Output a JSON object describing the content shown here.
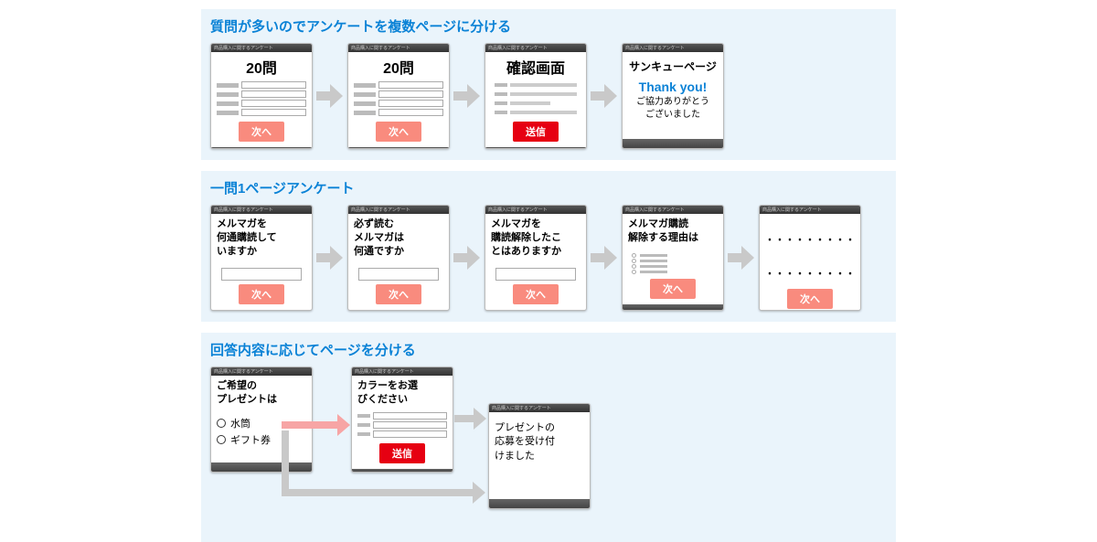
{
  "sections": [
    {
      "title": "質問が多いのでアンケートを複数ページに分ける",
      "cards": [
        {
          "header": "商品購入に関するアンケート",
          "title": "20問",
          "button": "次へ"
        },
        {
          "header": "商品購入に関するアンケート",
          "title": "20問",
          "button": "次へ"
        },
        {
          "header": "商品購入に関するアンケート",
          "title": "確認画面",
          "button": "送信"
        },
        {
          "header": "商品購入に関するアンケート",
          "thank_title": "サンキューページ",
          "thank_msg": "Thank you!",
          "thank_note1": "ご協力ありがとう",
          "thank_note2": "ございました"
        }
      ]
    },
    {
      "title": "一問1ページアンケート",
      "cards": [
        {
          "header": "商品購入に関するアンケート",
          "q1": "メルマガを",
          "q2": "何通購読して",
          "q3": "いますか",
          "button": "次へ"
        },
        {
          "header": "商品購入に関するアンケート",
          "q1": "必ず読む",
          "q2": "メルマガは",
          "q3": "何通ですか",
          "button": "次へ"
        },
        {
          "header": "商品購入に関するアンケート",
          "q1": "メルマガを",
          "q2": "購読解除したこ",
          "q3": "とはありますか",
          "button": "次へ"
        },
        {
          "header": "商品購入に関するアンケート",
          "q1": "メルマガ購読",
          "q2": "解除する理由は",
          "button": "次へ"
        },
        {
          "header": "商品購入に関するアンケート",
          "dots": "・・・・・・・・・",
          "dots2": "・・・・・・・・・",
          "button": "次へ"
        }
      ]
    },
    {
      "title": "回答内容に応じてページを分ける",
      "from": {
        "header": "商品購入に関するアンケート",
        "q1": "ご希望の",
        "q2": "プレゼントは",
        "opt1": "水筒",
        "opt2": "ギフト券"
      },
      "a": {
        "header": "商品購入に関するアンケート",
        "q1": "カラーをお選",
        "q2": "びください",
        "button": "送信"
      },
      "c": {
        "header": "商品購入に関するアンケート",
        "m1": "プレゼントの",
        "m2": "応募を受け付",
        "m3": "けました"
      }
    }
  ]
}
